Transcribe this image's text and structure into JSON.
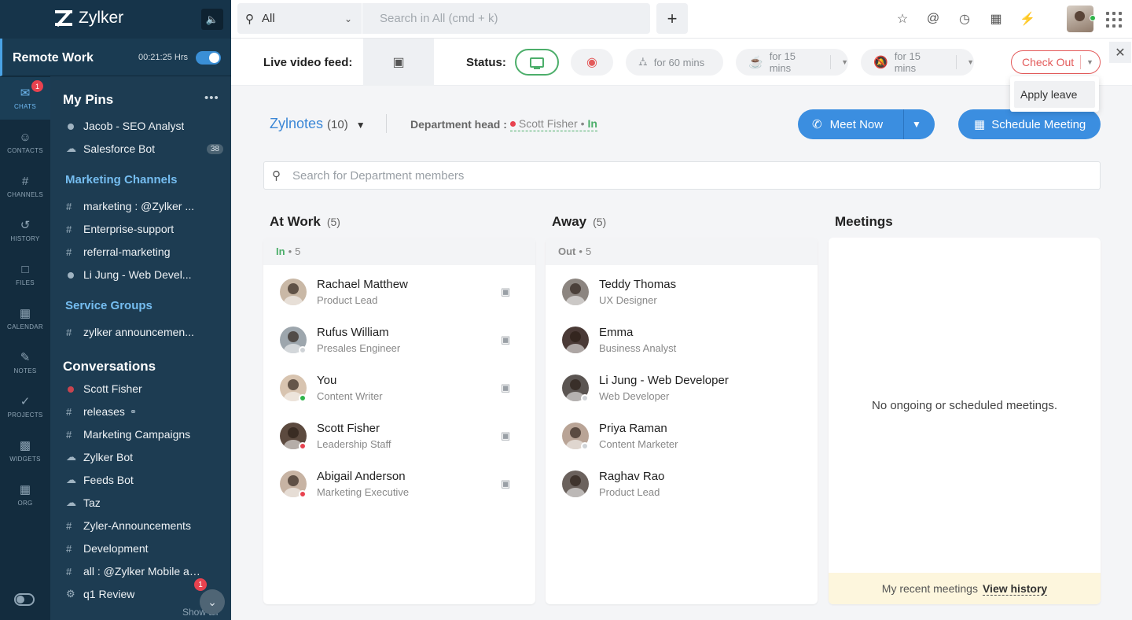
{
  "brand": {
    "name": "Zylker"
  },
  "workspace": {
    "name": "Remote Work",
    "timer": "00:21:25 Hrs"
  },
  "rail": [
    {
      "label": "CHATS",
      "icon": "chat-icon",
      "badge": "1"
    },
    {
      "label": "CONTACTS",
      "icon": "contacts-icon"
    },
    {
      "label": "CHANNELS",
      "icon": "hash-icon"
    },
    {
      "label": "HISTORY",
      "icon": "history-icon"
    },
    {
      "label": "FILES",
      "icon": "file-icon"
    },
    {
      "label": "CALENDAR",
      "icon": "calendar-icon"
    },
    {
      "label": "NOTES",
      "icon": "notes-icon"
    },
    {
      "label": "PROJECTS",
      "icon": "projects-icon"
    },
    {
      "label": "WIDGETS",
      "icon": "widgets-icon"
    },
    {
      "label": "ORG",
      "icon": "org-icon"
    }
  ],
  "sidebar": {
    "pins_title": "My Pins",
    "pins": [
      {
        "label": "Jacob -  SEO Analyst",
        "marker": "dot"
      },
      {
        "label": "Salesforce Bot",
        "marker": "bot",
        "count": "38"
      }
    ],
    "marketing_title": "Marketing Channels",
    "marketing": [
      {
        "label": "marketing : @Zylker ...",
        "marker": "#"
      },
      {
        "label": "Enterprise-support",
        "marker": "#"
      },
      {
        "label": "referral-marketing",
        "marker": "#"
      },
      {
        "label": "Li Jung - Web Devel...",
        "marker": "dot"
      }
    ],
    "service_title": "Service Groups",
    "service": [
      {
        "label": "zylker announcemen...",
        "marker": "#"
      }
    ],
    "conv_title": "Conversations",
    "conversations": [
      {
        "label": "Scott Fisher",
        "marker": "dot-red"
      },
      {
        "label": "releases",
        "marker": "#"
      },
      {
        "label": "Marketing Campaigns",
        "marker": "#"
      },
      {
        "label": "Zylker Bot",
        "marker": "bot"
      },
      {
        "label": "Feeds Bot",
        "marker": "bot"
      },
      {
        "label": "Taz",
        "marker": "bot"
      },
      {
        "label": "Zyler-Announcements",
        "marker": "#"
      },
      {
        "label": "Development",
        "marker": "#"
      },
      {
        "label": "all : @Zylker Mobile ap...",
        "marker": "#"
      },
      {
        "label": "q1 Review",
        "marker": "group",
        "badge": "1"
      }
    ],
    "show_all": "Show all"
  },
  "search": {
    "scope": "All",
    "placeholder": "Search in All (cmd + k)"
  },
  "status_bar": {
    "live_label": "Live video feed:",
    "status_label": "Status:",
    "lunch": "for 60 mins",
    "coffee": "for 15 mins",
    "dnd": "for 15 mins",
    "checkout": "Check Out",
    "apply_leave": "Apply leave"
  },
  "department": {
    "name": "Zylnotes",
    "count": "(10)",
    "head_label": "Department head :",
    "head_name": "Scott Fisher",
    "head_state": "In",
    "meet_now": "Meet Now",
    "schedule": "Schedule Meeting",
    "search_placeholder": "Search for Department members"
  },
  "columns": {
    "at_work": {
      "title": "At Work",
      "count": "(5)",
      "sub_state": "In",
      "sub_count": "5",
      "members": [
        {
          "name": "Rachael Matthew",
          "role": "Product Lead",
          "status": "none",
          "color": "#c9b8a6"
        },
        {
          "name": "Rufus William",
          "role": "Presales Engineer",
          "status": "grey",
          "color": "#9da6ad"
        },
        {
          "name": "You",
          "role": "Content Writer",
          "status": "green",
          "color": "#d8c4b0"
        },
        {
          "name": "Scott Fisher",
          "role": "Leadership Staff",
          "status": "red",
          "color": "#5c4a3f"
        },
        {
          "name": "Abigail Anderson",
          "role": "Marketing Executive",
          "status": "red",
          "color": "#c7b3a3"
        }
      ]
    },
    "away": {
      "title": "Away",
      "count": "(5)",
      "sub_state": "Out",
      "sub_count": "5",
      "members": [
        {
          "name": "Teddy Thomas",
          "role": "UX Designer",
          "status": "none",
          "color": "#8c8580"
        },
        {
          "name": "Emma",
          "role": "Business Analyst",
          "status": "none",
          "color": "#4a3a36"
        },
        {
          "name": "Li Jung - Web Developer",
          "role": "Web Developer",
          "status": "grey",
          "color": "#5b5552"
        },
        {
          "name": "Priya Raman",
          "role": "Content Marketer",
          "status": "grey",
          "color": "#b9a496"
        },
        {
          "name": "Raghav Rao",
          "role": "Product Lead",
          "status": "none",
          "color": "#6b625d"
        }
      ]
    },
    "meetings": {
      "title": "Meetings",
      "empty": "No ongoing or scheduled meetings.",
      "recent_label": "My recent meetings",
      "view_history": "View history"
    }
  }
}
